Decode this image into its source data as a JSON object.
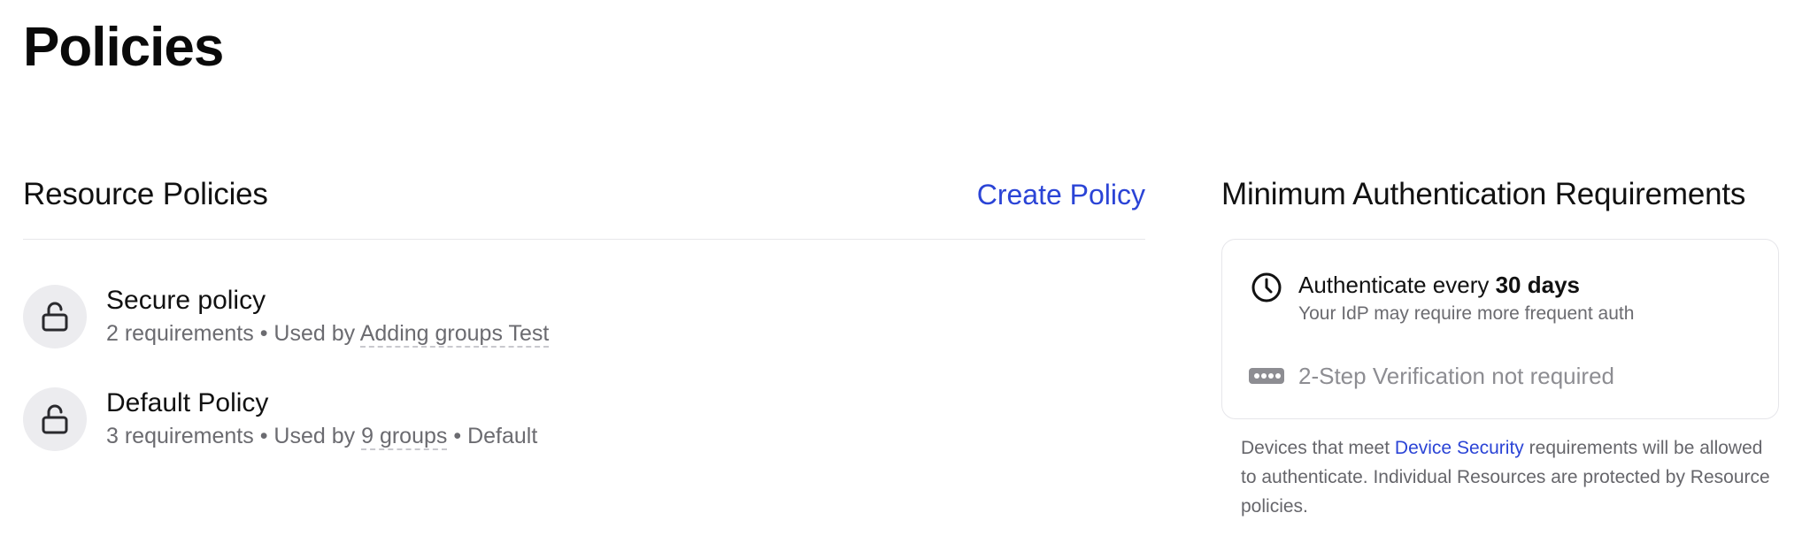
{
  "page": {
    "title": "Policies"
  },
  "resource_policies": {
    "title": "Resource Policies",
    "create_label": "Create Policy",
    "items": [
      {
        "icon": "lock-open-icon",
        "name": "Secure policy",
        "requirements": "2 requirements",
        "separator": "•",
        "used_by_prefix": "Used by",
        "used_by": "Adding groups Test",
        "default_label": ""
      },
      {
        "icon": "lock-open-icon",
        "name": "Default Policy",
        "requirements": "3 requirements",
        "separator": "•",
        "used_by_prefix": "Used by",
        "used_by": "9 groups",
        "default_label": "Default"
      }
    ]
  },
  "min_auth": {
    "title": "Minimum Authentication Requirements",
    "auth_prefix": "Authenticate every",
    "auth_period": "30 days",
    "auth_sub": "Your IdP may require more frequent auth",
    "twostep": "2-Step Verification not required",
    "note_before": "Devices that meet",
    "note_link": "Device Security",
    "note_after": "requirements will be allowed to authenticate. Individual Resources are protected by Resource policies."
  },
  "colors": {
    "accent": "#2b44d6",
    "muted_text": "#6b6b70",
    "icon_bg": "#ececef"
  }
}
